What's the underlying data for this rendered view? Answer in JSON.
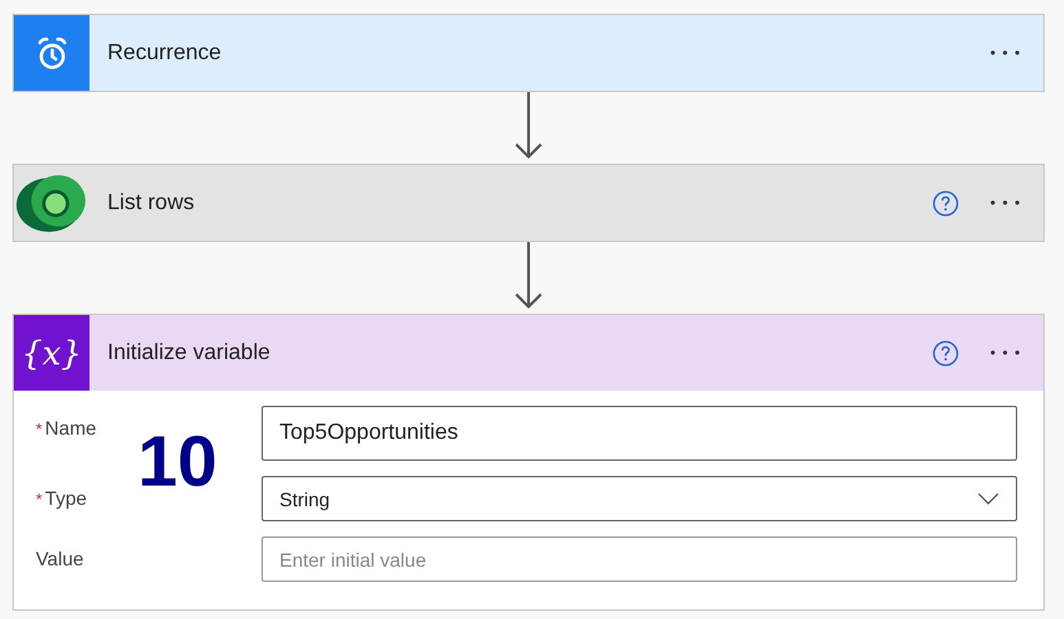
{
  "steps": [
    {
      "kind": "recurrence",
      "title": "Recurrence",
      "help": false,
      "menu": "• • •"
    },
    {
      "kind": "dataverse",
      "title": "List rows",
      "help": true,
      "menu": "• • •"
    },
    {
      "kind": "variable",
      "title": "Initialize variable",
      "icon_text": "{x}",
      "help": true,
      "menu": "• • •",
      "fields": [
        {
          "label": "Name",
          "required": true,
          "kind": "text",
          "value": "Top5Opportunities"
        },
        {
          "label": "Type",
          "required": true,
          "kind": "dropdown",
          "value": "String"
        },
        {
          "label": "Value",
          "required": false,
          "kind": "text",
          "placeholder": "Enter initial value"
        }
      ]
    }
  ],
  "required_mark": "*",
  "overlay_number": "10"
}
